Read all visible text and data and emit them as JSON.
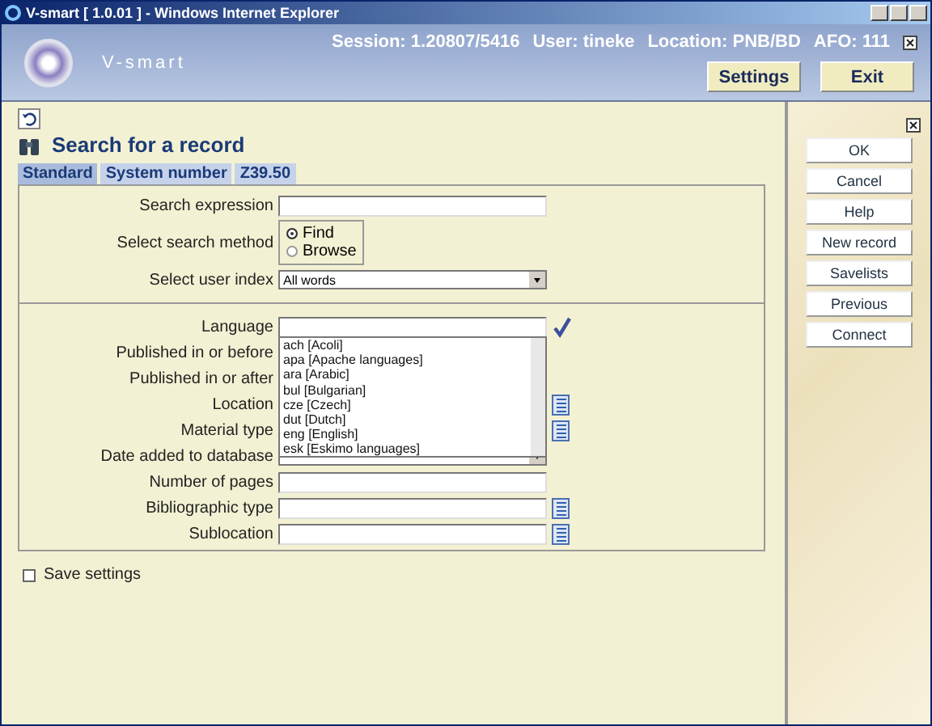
{
  "window": {
    "title": "V-smart [ 1.0.01 ] - Windows Internet Explorer"
  },
  "header": {
    "logo": "V-smart",
    "session": "Session: 1.20807/5416",
    "user": "User: tineke",
    "location": "Location: PNB/BD",
    "afo": "AFO: 111",
    "buttons": [
      "Settings",
      "Exit"
    ]
  },
  "page": {
    "title": "Search for a record"
  },
  "tabs": [
    {
      "label": "Standard",
      "selected": true
    },
    {
      "label": "System number",
      "selected": false
    },
    {
      "label": "Z39.50",
      "selected": false
    }
  ],
  "form": {
    "section_1": [
      {
        "label": "Search expression",
        "kind": "text"
      },
      {
        "label": "Select search method",
        "kind": "radio",
        "options": [
          {
            "label": "Find",
            "selected": true
          },
          {
            "label": "Browse",
            "selected": false
          }
        ]
      },
      {
        "label": "Select user index",
        "kind": "select",
        "value": "All words"
      }
    ],
    "section_2": [
      {
        "label": "Language",
        "kind": "check"
      },
      {
        "label": "Published in or before",
        "kind": "text"
      },
      {
        "label": "Published in or after",
        "kind": "text"
      },
      {
        "label": "Location",
        "kind": "list"
      },
      {
        "label": "Material type",
        "kind": "list"
      },
      {
        "label": "Date added to database",
        "kind": "select"
      },
      {
        "label": "Number of pages",
        "kind": "text"
      },
      {
        "label": "Bibliographic type",
        "kind": "list"
      },
      {
        "label": "Sublocation",
        "kind": "list"
      }
    ],
    "language_options": [
      "ach [Acoli]",
      "apa [Apache languages]",
      "ara [Arabic]",
      "bul [Bulgarian]",
      "cze [Czech]",
      "dut [Dutch]",
      "eng [English]",
      "esk [Eskimo languages]"
    ]
  },
  "save_settings": {
    "label": "Save settings",
    "checked": false
  },
  "side_buttons": [
    "OK",
    "Cancel",
    "Help",
    "New record",
    "Savelists",
    "Previous",
    "Connect"
  ]
}
